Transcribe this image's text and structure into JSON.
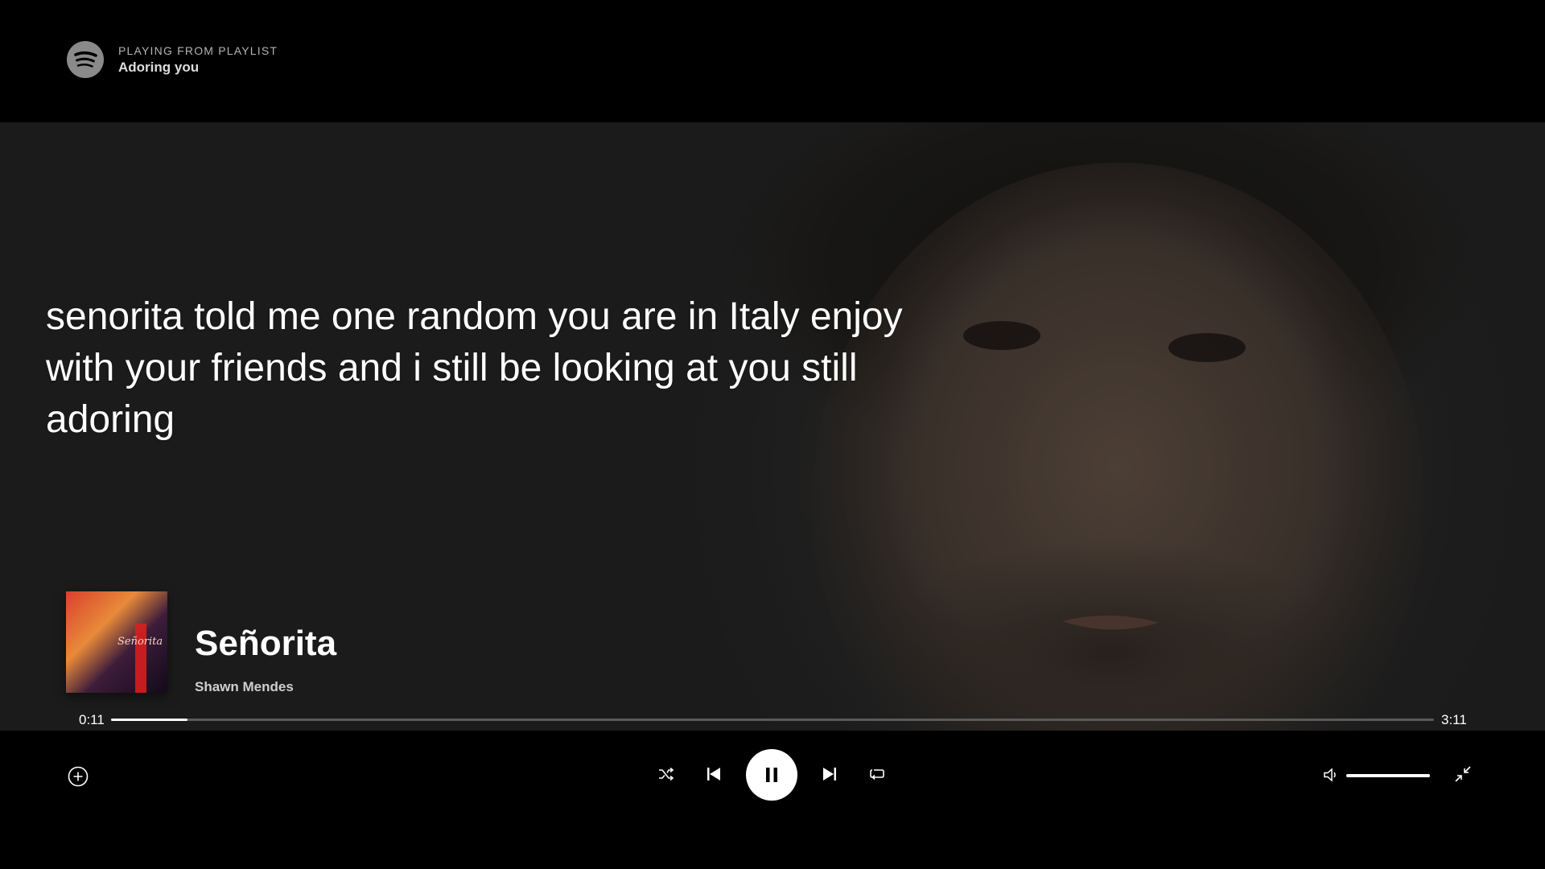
{
  "context": {
    "label": "PLAYING FROM PLAYLIST",
    "name": "Adoring you"
  },
  "lyrics": "senorita told me one random you are in Italy enjoy with your friends and i still be looking at you still adoring",
  "track": {
    "title": "Señorita",
    "artist": "Shawn Mendes",
    "cover_text": "Señorita",
    "elapsed": "0:11",
    "duration": "3:11",
    "progress_fraction": 0.058
  },
  "volume_fraction": 1.0,
  "icons": {
    "logo": "spotify-logo-icon",
    "add": "plus-circle-icon",
    "shuffle": "shuffle-icon",
    "previous": "skip-back-icon",
    "play_pause": "pause-icon",
    "next": "skip-forward-icon",
    "repeat": "repeat-icon",
    "volume": "volume-icon",
    "exit_fullscreen": "minimize-icon"
  },
  "colors": {
    "background": "#000000",
    "text": "#ffffff",
    "muted": "#b3b3b3",
    "track_bg": "#5a5a5a"
  }
}
